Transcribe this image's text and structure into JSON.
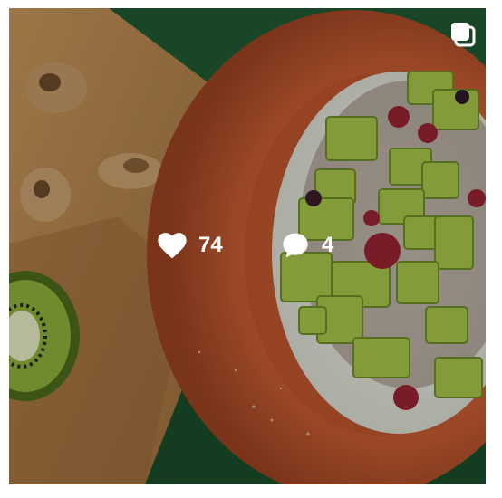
{
  "post": {
    "likes_count": "74",
    "comments_count": "4",
    "overlay_icons": {
      "likes": "heart-icon",
      "comments": "speech-bubble-icon",
      "gallery": "multiple-photos-icon"
    },
    "colors": {
      "overlay_text": "#ffffff",
      "background_cloth": "#1f5a32",
      "cutting_board": "#b9874e",
      "bowl": "#c45c34",
      "kiwi": "#a8c84a"
    }
  }
}
